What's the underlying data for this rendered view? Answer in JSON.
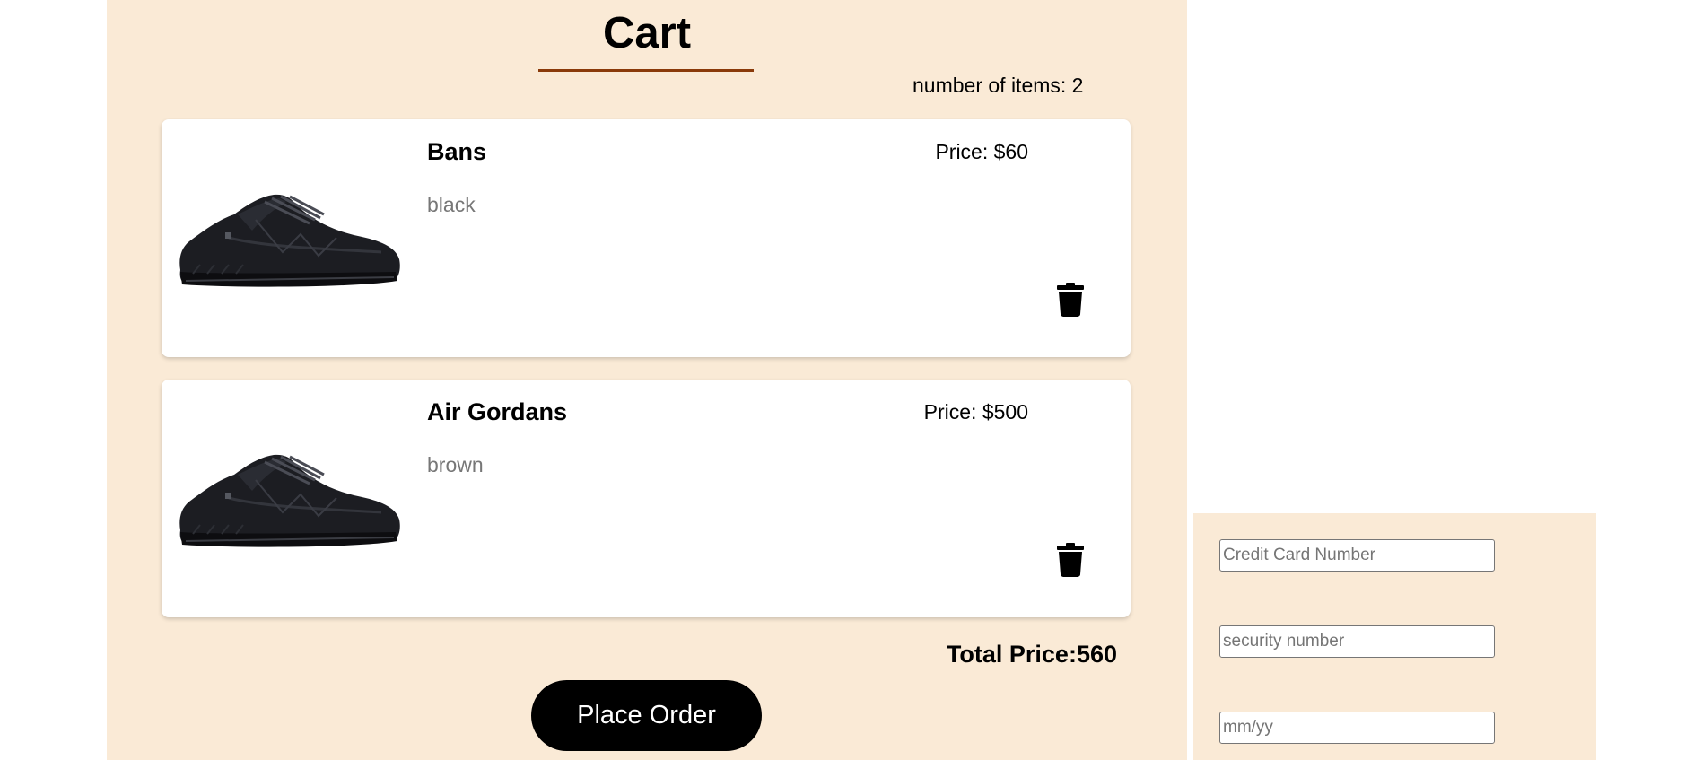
{
  "cart": {
    "title": "Cart",
    "item_count_text": "number of items: 2",
    "items": [
      {
        "name": "Bans",
        "color": "black",
        "price_text": "Price: $60",
        "image_icon": "black-sneaker-image",
        "delete_icon": "trash-icon"
      },
      {
        "name": "Air Gordans",
        "color": "brown",
        "price_text": "Price: $500",
        "image_icon": "black-sneaker-image",
        "delete_icon": "trash-icon"
      }
    ],
    "total_price_text": "Total Price:560",
    "place_order_label": "Place Order"
  },
  "payment": {
    "credit_card_placeholder": "Credit Card Number",
    "security_placeholder": "security number",
    "expiry_placeholder": "mm/yy"
  },
  "colors": {
    "panel_background": "#faead6",
    "underline": "#8a3a0a",
    "button": "#000000",
    "secondary_text": "#777777"
  }
}
